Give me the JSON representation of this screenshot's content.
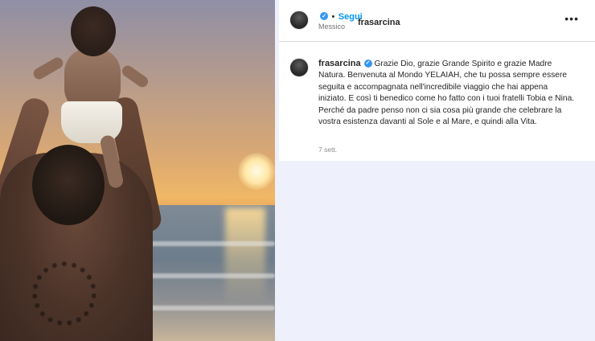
{
  "post": {
    "username": "frasarcina",
    "follow_label": "Segui",
    "separator": "•",
    "location": "Messico",
    "more_label": "•••",
    "caption_username": "frasarcina",
    "caption_text": "Grazie Dio, grazie Grande Spirito e grazie Madre Natura. Benvenuta al Mondo YELAIAH, che tu possa sempre essere seguita e accompagnata nell'incredibile viaggio che hai appena iniziato. E così ti benedico come ho fatto con i tuoi fratelli Tobia e Nina. Perché da padre penso non ci sia cosa più grande che celebrare la vostra esistenza davanti al Sole e al Mare, e quindi alla Vita.",
    "timestamp": "7 sett."
  },
  "icons": {
    "verified": "verified-badge-icon",
    "more": "more-options-icon"
  },
  "colors": {
    "follow": "#0095f6",
    "verified": "#3897f0",
    "panel_bg": "#ffffff",
    "page_bg": "#eef0fb"
  }
}
